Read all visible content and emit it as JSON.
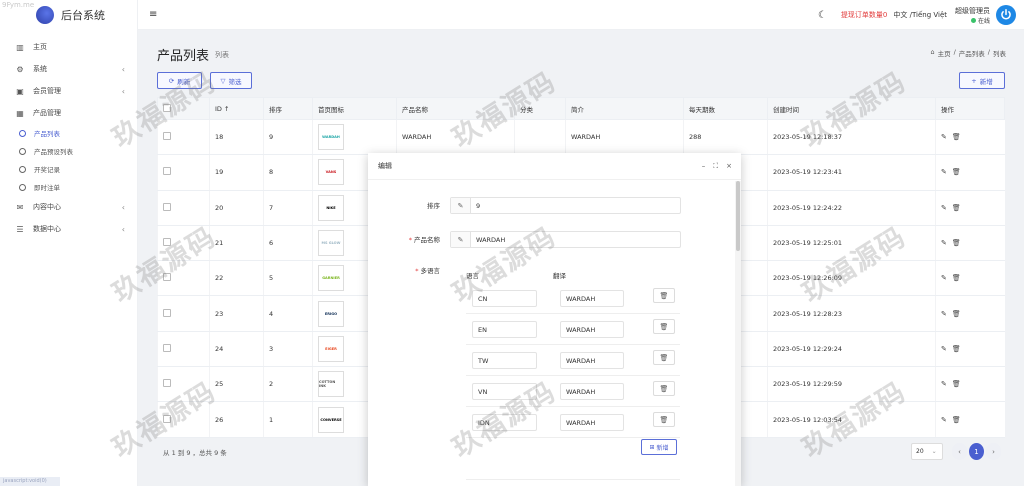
{
  "corner_watermark": "9Fym.me",
  "brand": {
    "name": "后台系统"
  },
  "sidebar": {
    "items": [
      {
        "label": "主页",
        "icon": "bar-chart-icon",
        "glyph": "▥"
      },
      {
        "label": "系统",
        "icon": "gear-icon",
        "glyph": "⚙",
        "arrow": "‹"
      },
      {
        "label": "会员管理",
        "icon": "id-card-icon",
        "glyph": "▣",
        "arrow": "‹"
      },
      {
        "label": "产品管理",
        "icon": "grid-icon",
        "glyph": "▦"
      }
    ],
    "sub_items": [
      {
        "label": "产品列表",
        "active": true
      },
      {
        "label": "产品预设列表"
      },
      {
        "label": "开奖记录"
      },
      {
        "label": "即时注单"
      }
    ],
    "items_after": [
      {
        "label": "内容中心",
        "icon": "chat-icon",
        "glyph": "✉",
        "arrow": "‹"
      },
      {
        "label": "数据中心",
        "icon": "database-icon",
        "glyph": "☰",
        "arrow": "‹"
      }
    ],
    "bottom_hint": "javascript:void(0)"
  },
  "topbar": {
    "hamburger": "≡",
    "theme_icon": "☾",
    "order_alert": "提现订单数量0",
    "language": "中文 /Tiếng Việt",
    "user_name": "超级管理员",
    "user_status": "在线"
  },
  "page": {
    "title": "产品列表",
    "subtitle": "列表",
    "breadcrumb": [
      "主页",
      "/",
      "产品列表",
      "/",
      "列表"
    ],
    "home_icon": "⌂"
  },
  "toolbar": {
    "refresh_label": "刷新",
    "refresh_icon": "⟳",
    "filter_label": "筛选",
    "filter_icon": "▽",
    "add_label": "新增",
    "add_icon": "+"
  },
  "table": {
    "headers": [
      "ID ↑",
      "排序",
      "首页图标",
      "产品名称",
      "分类",
      "简介",
      "每天期数",
      "创建时间",
      "操作"
    ],
    "rows": [
      {
        "id": "18",
        "sort": "9",
        "logo": "WARDAH",
        "logo_color": "#1aa5a5",
        "name": "WARDAH",
        "category": "",
        "intro": "WARDAH",
        "periods": "288",
        "created": "2023-05-19 12:18:37"
      },
      {
        "id": "19",
        "sort": "8",
        "logo": "VANS",
        "logo_color": "#c9161d",
        "name": "",
        "category": "",
        "intro": "",
        "periods": "",
        "created": "2023-05-19 12:23:41"
      },
      {
        "id": "20",
        "sort": "7",
        "logo": "NIKE",
        "logo_color": "#000000",
        "name": "",
        "category": "",
        "intro": "",
        "periods": "",
        "created": "2023-05-19 12:24:22"
      },
      {
        "id": "21",
        "sort": "6",
        "logo": "MS GLOW",
        "logo_color": "#9fb8c6",
        "name": "",
        "category": "",
        "intro": "",
        "periods": "",
        "created": "2023-05-19 12:25:01"
      },
      {
        "id": "22",
        "sort": "5",
        "logo": "GARNIER",
        "logo_color": "#7ab51d",
        "name": "",
        "category": "",
        "intro": "",
        "periods": "",
        "created": "2023-05-19 12:26:09"
      },
      {
        "id": "23",
        "sort": "4",
        "logo": "ERIGO",
        "logo_color": "#0d2c54",
        "name": "",
        "category": "",
        "intro": "",
        "periods": "",
        "created": "2023-05-19 12:28:23"
      },
      {
        "id": "24",
        "sort": "3",
        "logo": "EIGER",
        "logo_color": "#e8461e",
        "name": "",
        "category": "",
        "intro": "",
        "periods": "",
        "created": "2023-05-19 12:29:24"
      },
      {
        "id": "25",
        "sort": "2",
        "logo": "COTTON INK",
        "logo_color": "#555555",
        "name": "",
        "category": "",
        "intro": "",
        "periods": "",
        "created": "2023-05-19 12:29:59"
      },
      {
        "id": "26",
        "sort": "1",
        "logo": "CONVERSE",
        "logo_color": "#000000",
        "name": "",
        "category": "",
        "intro": "",
        "periods": "",
        "created": "2023-05-19 12:03:54"
      }
    ]
  },
  "footer": {
    "info": "从 1 到 9 ，总共 9 条",
    "page_size": "20",
    "prev": "‹",
    "current_page": "1",
    "next": "›"
  },
  "modal": {
    "title": "编辑",
    "tools": [
      "–",
      "⛶",
      "×"
    ],
    "sort_label": "排序",
    "sort_value": "9",
    "name_label": "产品名称",
    "name_value": "WARDAH",
    "lang_label": "多语言",
    "lang_col": "语言",
    "trans_col": "翻译",
    "langs": [
      {
        "code": "CN",
        "text": "WARDAH"
      },
      {
        "code": "EN",
        "text": "WARDAH"
      },
      {
        "code": "TW",
        "text": "WARDAH"
      },
      {
        "code": "VN",
        "text": "WARDAH"
      },
      {
        "code": "IDN",
        "text": "WARDAH"
      }
    ],
    "add_lang_label": "新增"
  },
  "watermark_text": "玖福源码"
}
